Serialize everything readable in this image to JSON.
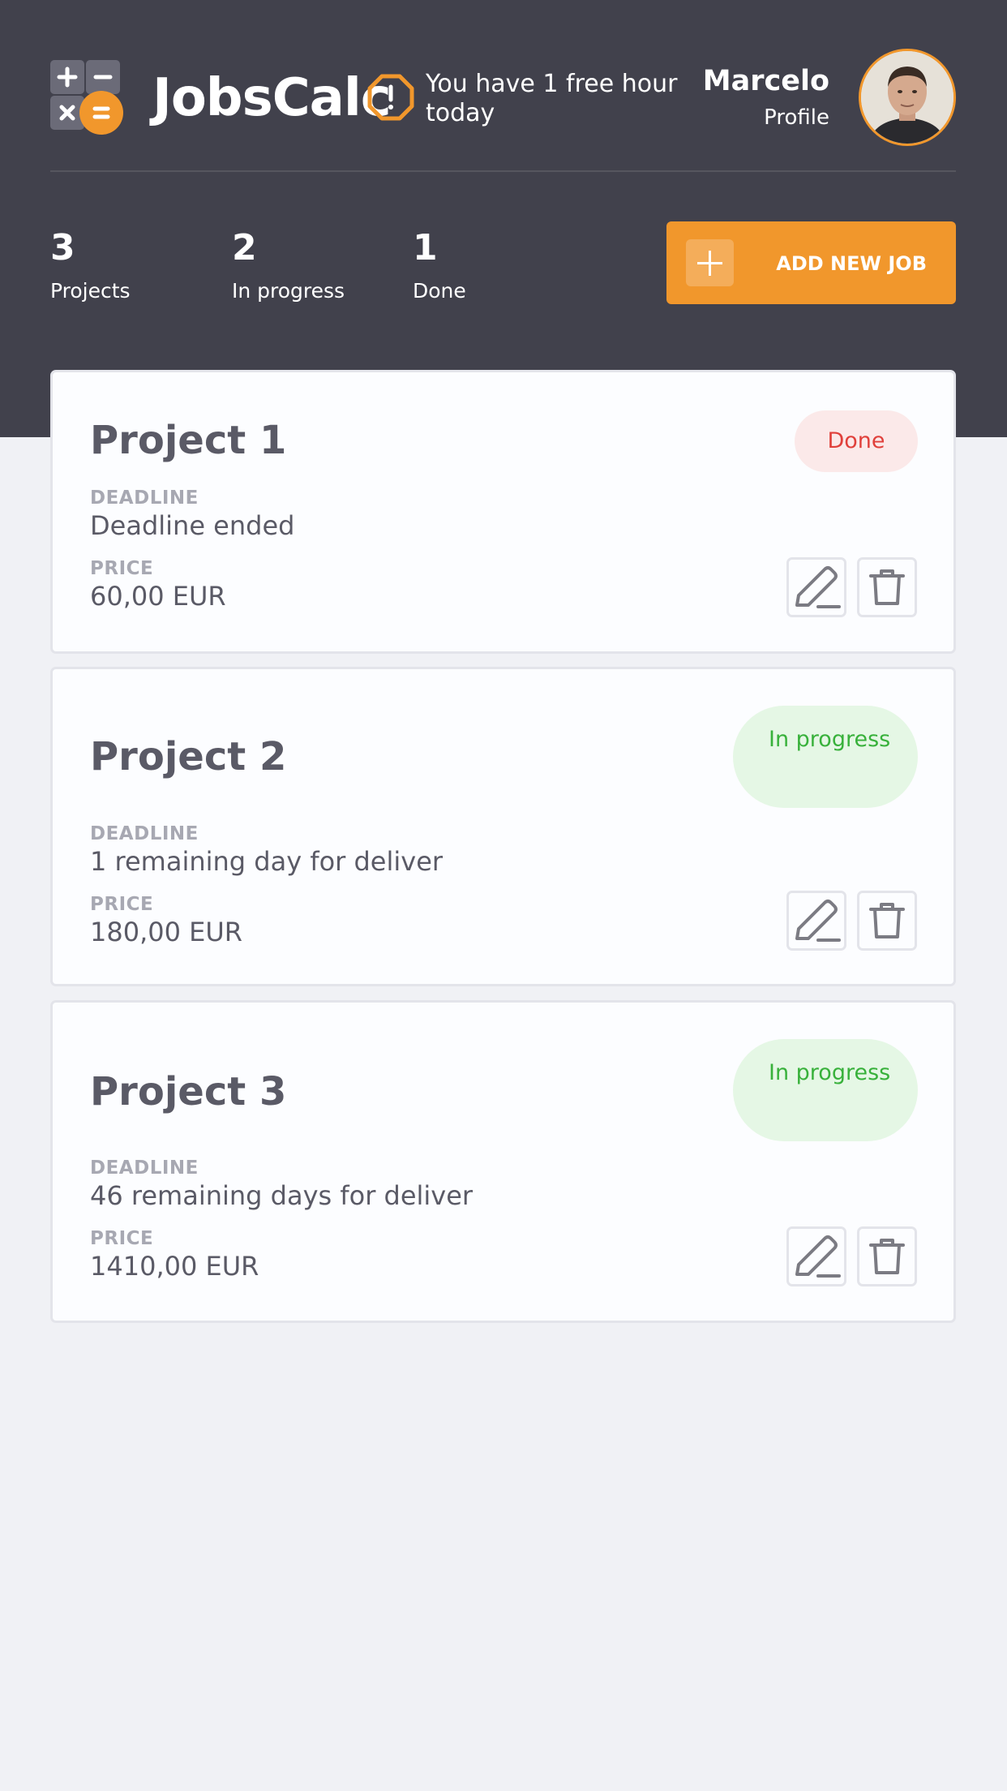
{
  "app": {
    "name": "JobsCalc",
    "free_hours_message": "You have 1 free hour today"
  },
  "user": {
    "name": "Marcelo",
    "profile_link": "Profile"
  },
  "stats": [
    {
      "value": "3",
      "label": "Projects"
    },
    {
      "value": "2",
      "label": "In progress"
    },
    {
      "value": "1",
      "label": "Done"
    }
  ],
  "add_job_label": "ADD NEW JOB",
  "field_labels": {
    "deadline": "DEADLINE",
    "price": "PRICE"
  },
  "projects": [
    {
      "title": "Project 1",
      "status": "Done",
      "deadline": "Deadline ended",
      "price": "60,00 EUR"
    },
    {
      "title": "Project 2",
      "status": "In progress",
      "deadline": "1 remaining day for deliver",
      "price": "180,00 EUR"
    },
    {
      "title": "Project 3",
      "status": "In progress",
      "deadline": "46 remaining days for deliver",
      "price": "1410,00 EUR"
    }
  ],
  "icons": {
    "logo": "calculator-icon",
    "alert": "alert-octagon-icon",
    "add": "plus-icon",
    "edit": "pencil-icon",
    "delete": "trash-icon"
  },
  "colors": {
    "header": "#41414c",
    "accent": "#f1972c",
    "done": "#e0403b",
    "in_progress": "#38b13b",
    "background": "#f0f1f5"
  }
}
